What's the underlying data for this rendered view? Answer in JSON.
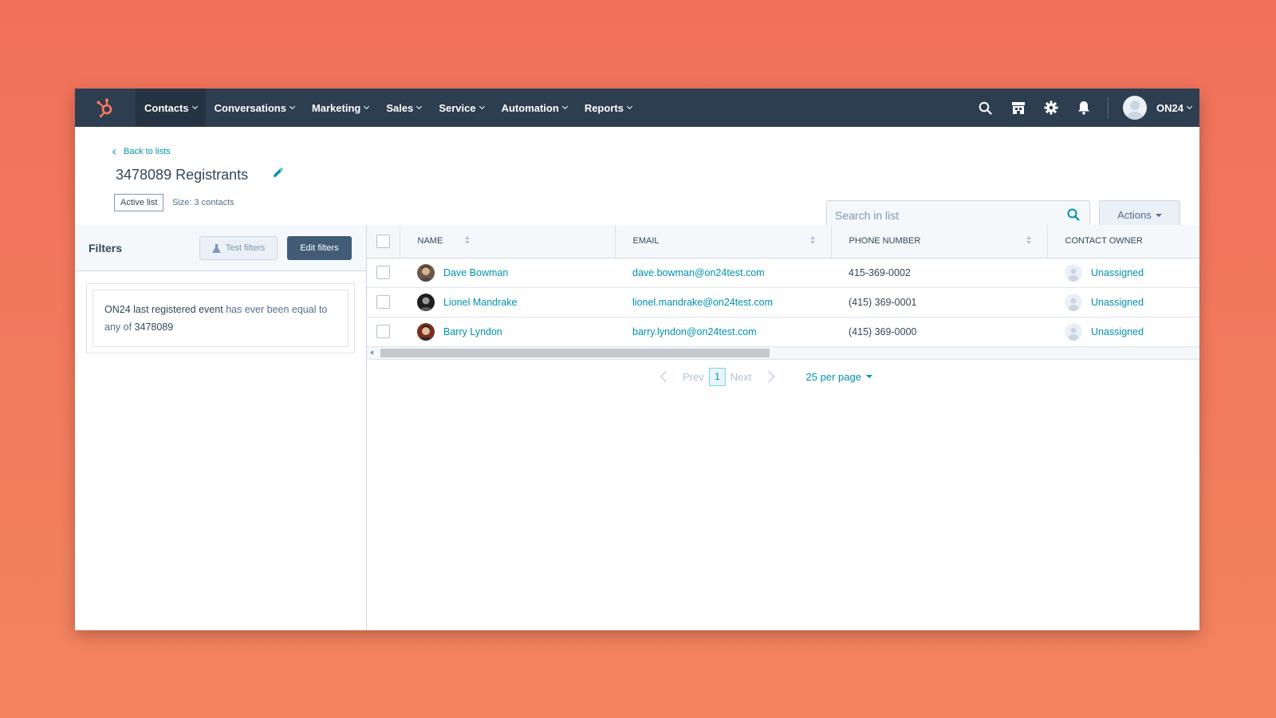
{
  "nav": {
    "items": [
      {
        "label": "Contacts",
        "active": true
      },
      {
        "label": "Conversations"
      },
      {
        "label": "Marketing"
      },
      {
        "label": "Sales"
      },
      {
        "label": "Service"
      },
      {
        "label": "Automation"
      },
      {
        "label": "Reports"
      }
    ],
    "account_name": "ON24",
    "icons": [
      "search-icon",
      "marketplace-icon",
      "settings-icon",
      "notifications-icon"
    ],
    "bg_color": "#2d3e50",
    "logo_color": "#ff7a59"
  },
  "header": {
    "back_label": "Back to lists",
    "title": "3478089 Registrants",
    "badge": "Active list",
    "size": "Size: 3 contacts",
    "search_placeholder": "Search in list",
    "actions_label": "Actions"
  },
  "filters": {
    "title": "Filters",
    "test_label": "Test filters",
    "edit_label": "Edit filters",
    "rule": {
      "property": "ON24 last registered event",
      "operator": "has ever been equal to any of",
      "value": "3478089"
    }
  },
  "table": {
    "columns": [
      "NAME",
      "EMAIL",
      "PHONE NUMBER",
      "CONTACT OWNER"
    ],
    "rows": [
      {
        "name": "Dave Bowman",
        "email": "dave.bowman@on24test.com",
        "phone": "415-369-0002",
        "owner": "Unassigned"
      },
      {
        "name": "Lionel Mandrake",
        "email": "lionel.mandrake@on24test.com",
        "phone": "(415) 369-0001",
        "owner": "Unassigned"
      },
      {
        "name": "Barry Lyndon",
        "email": "barry.lyndon@on24test.com",
        "phone": "(415) 369-0000",
        "owner": "Unassigned"
      }
    ]
  },
  "pagination": {
    "prev": "Prev",
    "current": "1",
    "next": "Next",
    "per_page": "25 per page"
  },
  "colors": {
    "accent": "#0091ae",
    "primary_button": "#425b76",
    "background_gradient": [
      "#f1705a",
      "#f38460"
    ]
  }
}
